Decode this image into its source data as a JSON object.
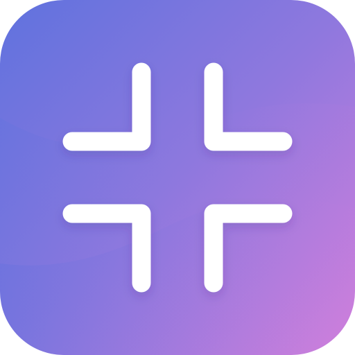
{
  "app_icon": {
    "icon_name": "exit-fullscreen-icon",
    "gradient_start": "#5f72de",
    "gradient_mid": "#8f78de",
    "gradient_end": "#d17fdc",
    "glyph_color": "#ffffff"
  }
}
